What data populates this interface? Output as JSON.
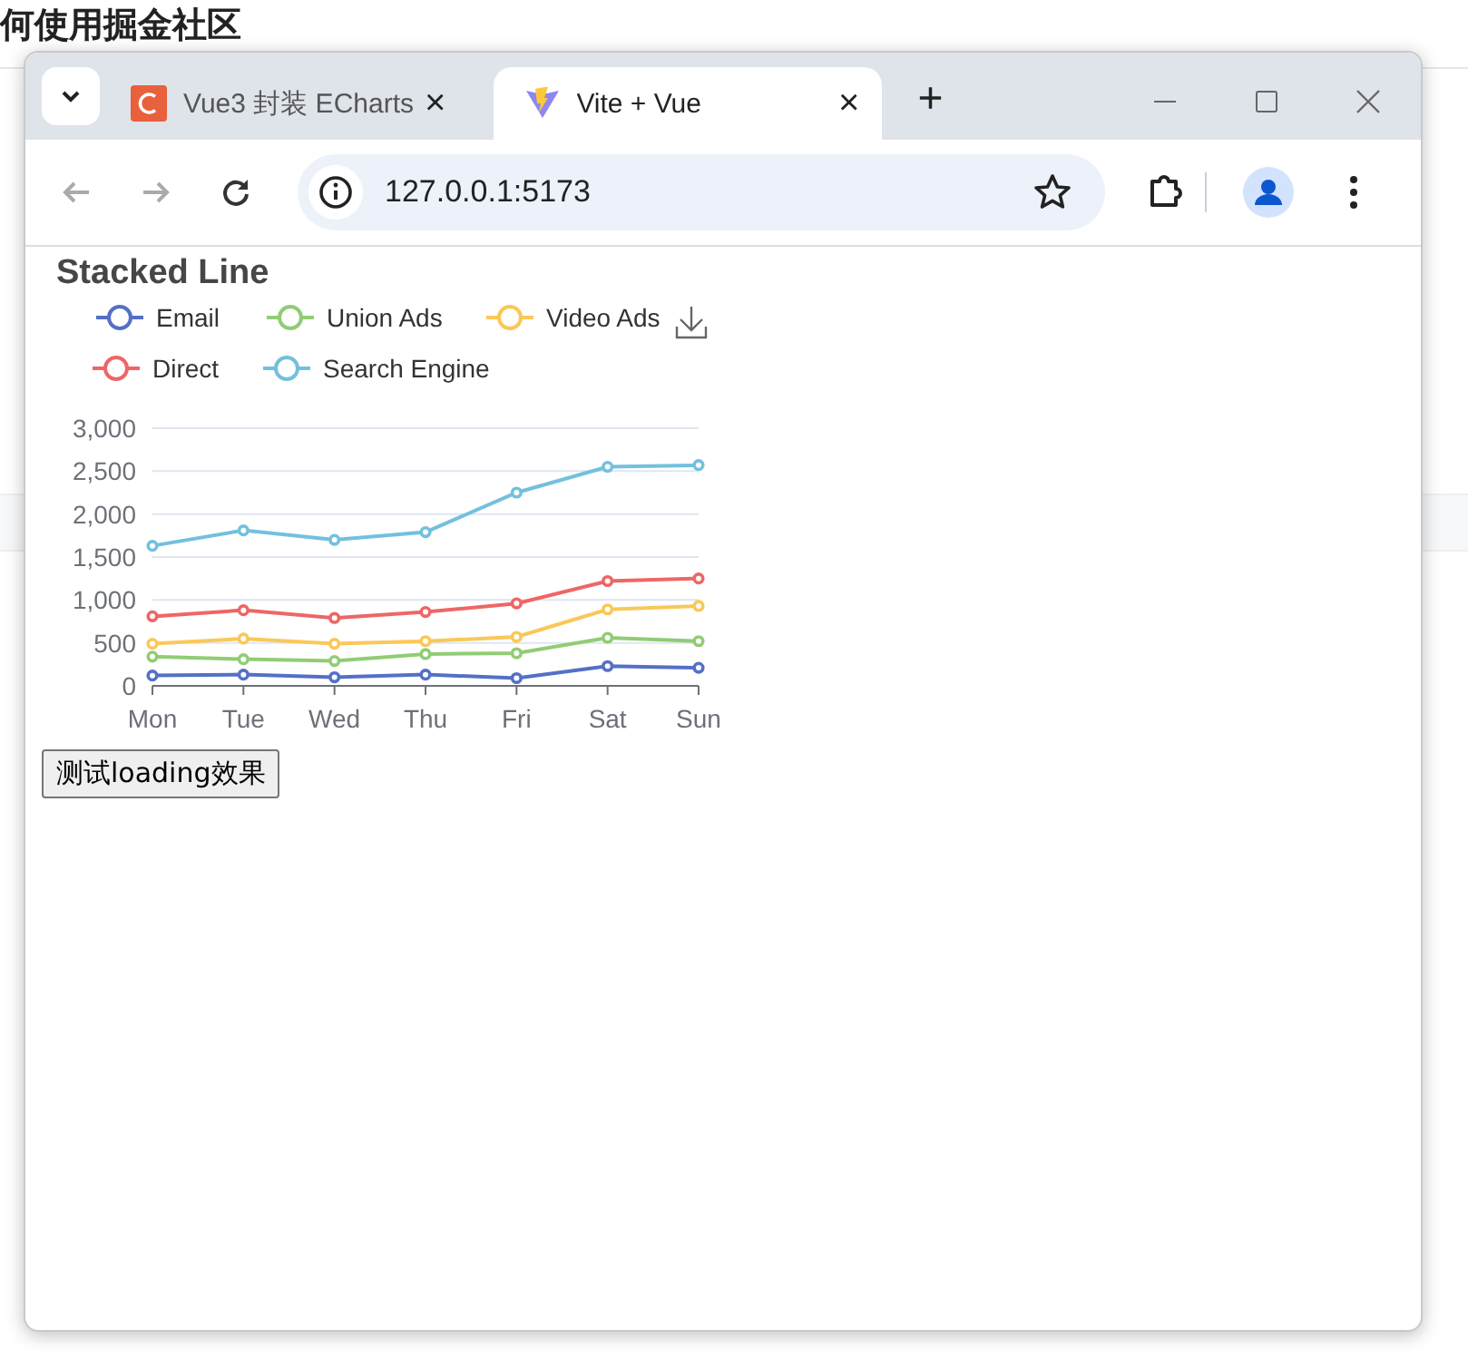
{
  "background_page": {
    "heading": "何使用掘金社区"
  },
  "browser": {
    "tabs": [
      {
        "title": "Vue3 封装 ECharts",
        "selected": false,
        "close": "×"
      },
      {
        "title": "Vite + Vue",
        "selected": true,
        "close": "×"
      }
    ],
    "new_tab": "+",
    "back_disabled": true,
    "forward_disabled": true,
    "address": "127.0.0.1:5173"
  },
  "page": {
    "chart": {
      "chart_data": {
        "type": "line",
        "title": "Stacked Line",
        "grid": true,
        "legend": "top",
        "categories": [
          "Mon",
          "Tue",
          "Wed",
          "Thu",
          "Fri",
          "Sat",
          "Sun"
        ],
        "series": [
          {
            "name": "Email",
            "color": "#5470c6",
            "marker": "empty_circle",
            "values": [
              120,
              130,
              100,
              130,
              90,
              230,
              210
            ]
          },
          {
            "name": "Union Ads",
            "color": "#91cc75",
            "marker": "empty_circle",
            "values": [
              340,
              310,
              290,
              370,
              380,
              560,
              520
            ]
          },
          {
            "name": "Video Ads",
            "color": "#fac858",
            "marker": "empty_circle",
            "values": [
              490,
              550,
              490,
              520,
              570,
              890,
              930
            ]
          },
          {
            "name": "Direct",
            "color": "#ee6666",
            "marker": "empty_circle",
            "values": [
              810,
              880,
              790,
              860,
              960,
              1220,
              1250
            ]
          },
          {
            "name": "Search Engine",
            "color": "#73c0de",
            "marker": "empty_circle",
            "values": [
              1630,
              1810,
              1700,
              1790,
              2250,
              2550,
              2570
            ]
          }
        ],
        "ylim": [
          0,
          3000
        ],
        "yticks": [
          {
            "value": 0,
            "label": "0"
          },
          {
            "value": 500,
            "label": "500"
          },
          {
            "value": 1000,
            "label": "1,000"
          },
          {
            "value": 1500,
            "label": "1,500"
          },
          {
            "value": 2000,
            "label": "2,000"
          },
          {
            "value": 2500,
            "label": "2,500"
          },
          {
            "value": 3000,
            "label": "3,000"
          }
        ]
      }
    },
    "button": "测试loading效果"
  }
}
